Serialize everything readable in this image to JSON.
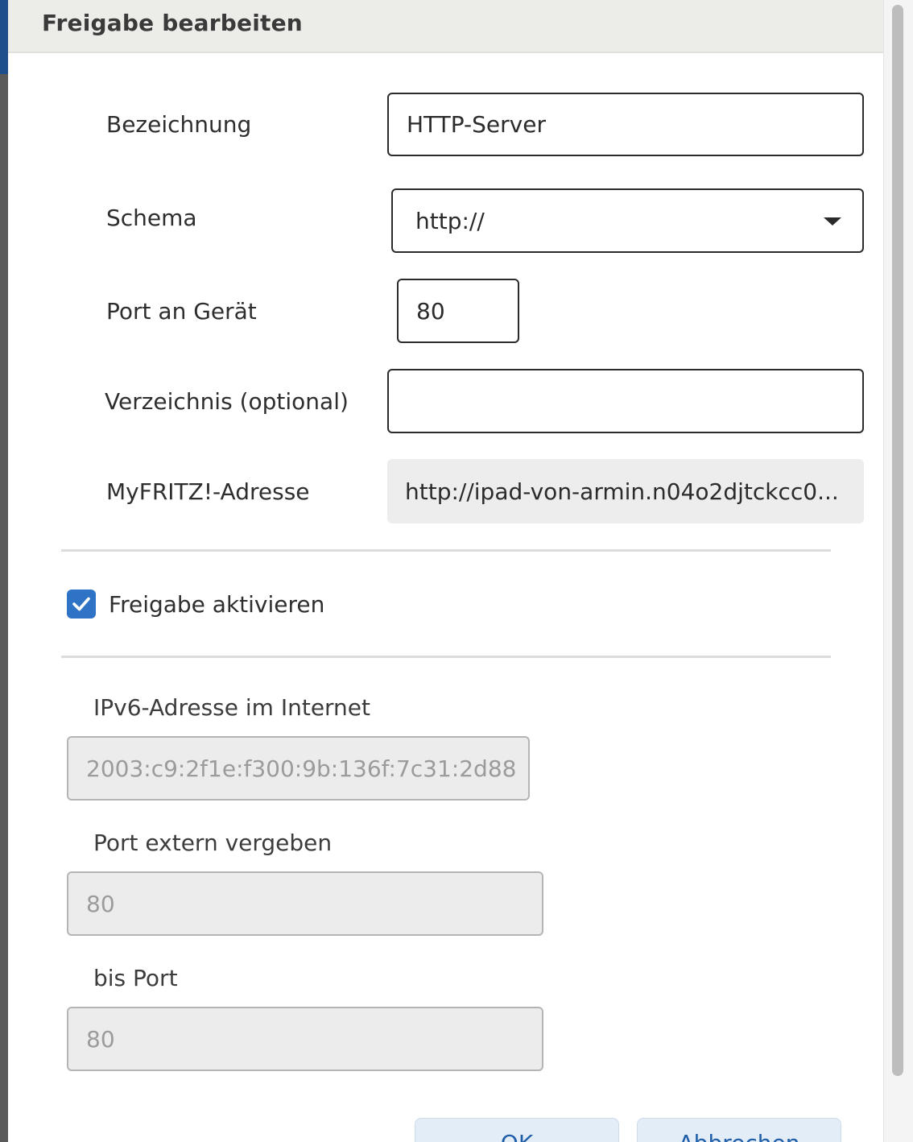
{
  "dialog": {
    "title": "Freigabe bearbeiten"
  },
  "form": {
    "bezeichnung": {
      "label": "Bezeichnung",
      "value": "HTTP-Server"
    },
    "schema": {
      "label": "Schema",
      "value": "http://"
    },
    "port_geraet": {
      "label": "Port an Gerät",
      "value": "80"
    },
    "verzeichnis": {
      "label": "Verzeichnis (optional)",
      "value": ""
    },
    "myfritz": {
      "label": "MyFRITZ!-Adresse",
      "value": "http://ipad-von-armin.n04o2djtckcc0..."
    }
  },
  "activation": {
    "label": "Freigabe aktivieren",
    "checked": true
  },
  "advanced": {
    "ipv6": {
      "label": "IPv6-Adresse im Internet",
      "value": "2003:c9:2f1e:f300:9b:136f:7c31:2d88"
    },
    "port_extern": {
      "label": "Port extern vergeben",
      "value": "80"
    },
    "bis_port": {
      "label": "bis Port",
      "value": "80"
    }
  },
  "buttons": {
    "ok": "OK",
    "cancel": "Abbrechen"
  },
  "colors": {
    "accent": "#2f73c7",
    "header_bg": "#ecece9"
  }
}
